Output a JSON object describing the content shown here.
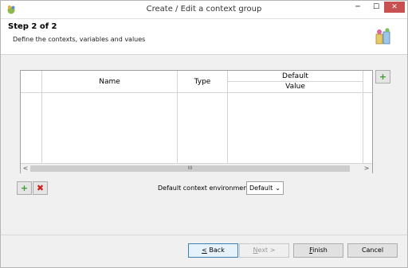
{
  "window": {
    "title": "Create / Edit a context group",
    "controls": {
      "minimize": "─",
      "maximize": "☐",
      "close": "✕"
    }
  },
  "header": {
    "step": "Step 2 of 2",
    "subtitle": "Define the contexts, variables and values"
  },
  "table": {
    "columns": {
      "name": "Name",
      "type": "Type",
      "group": "Default",
      "value": "Value"
    },
    "scroll": {
      "left": "<",
      "right": ">",
      "thumb": "III"
    }
  },
  "env": {
    "label": "Default context environment",
    "selected": "Default"
  },
  "buttons": {
    "back_mnemonic": "<",
    "back_rest": " Back",
    "next_mnemonic": "N",
    "next_rest": "ext >",
    "finish_mnemonic": "F",
    "finish_rest": "inish",
    "cancel": "Cancel"
  },
  "icons": {
    "add_column": "+",
    "add_row": "+",
    "remove_row": "✖"
  }
}
